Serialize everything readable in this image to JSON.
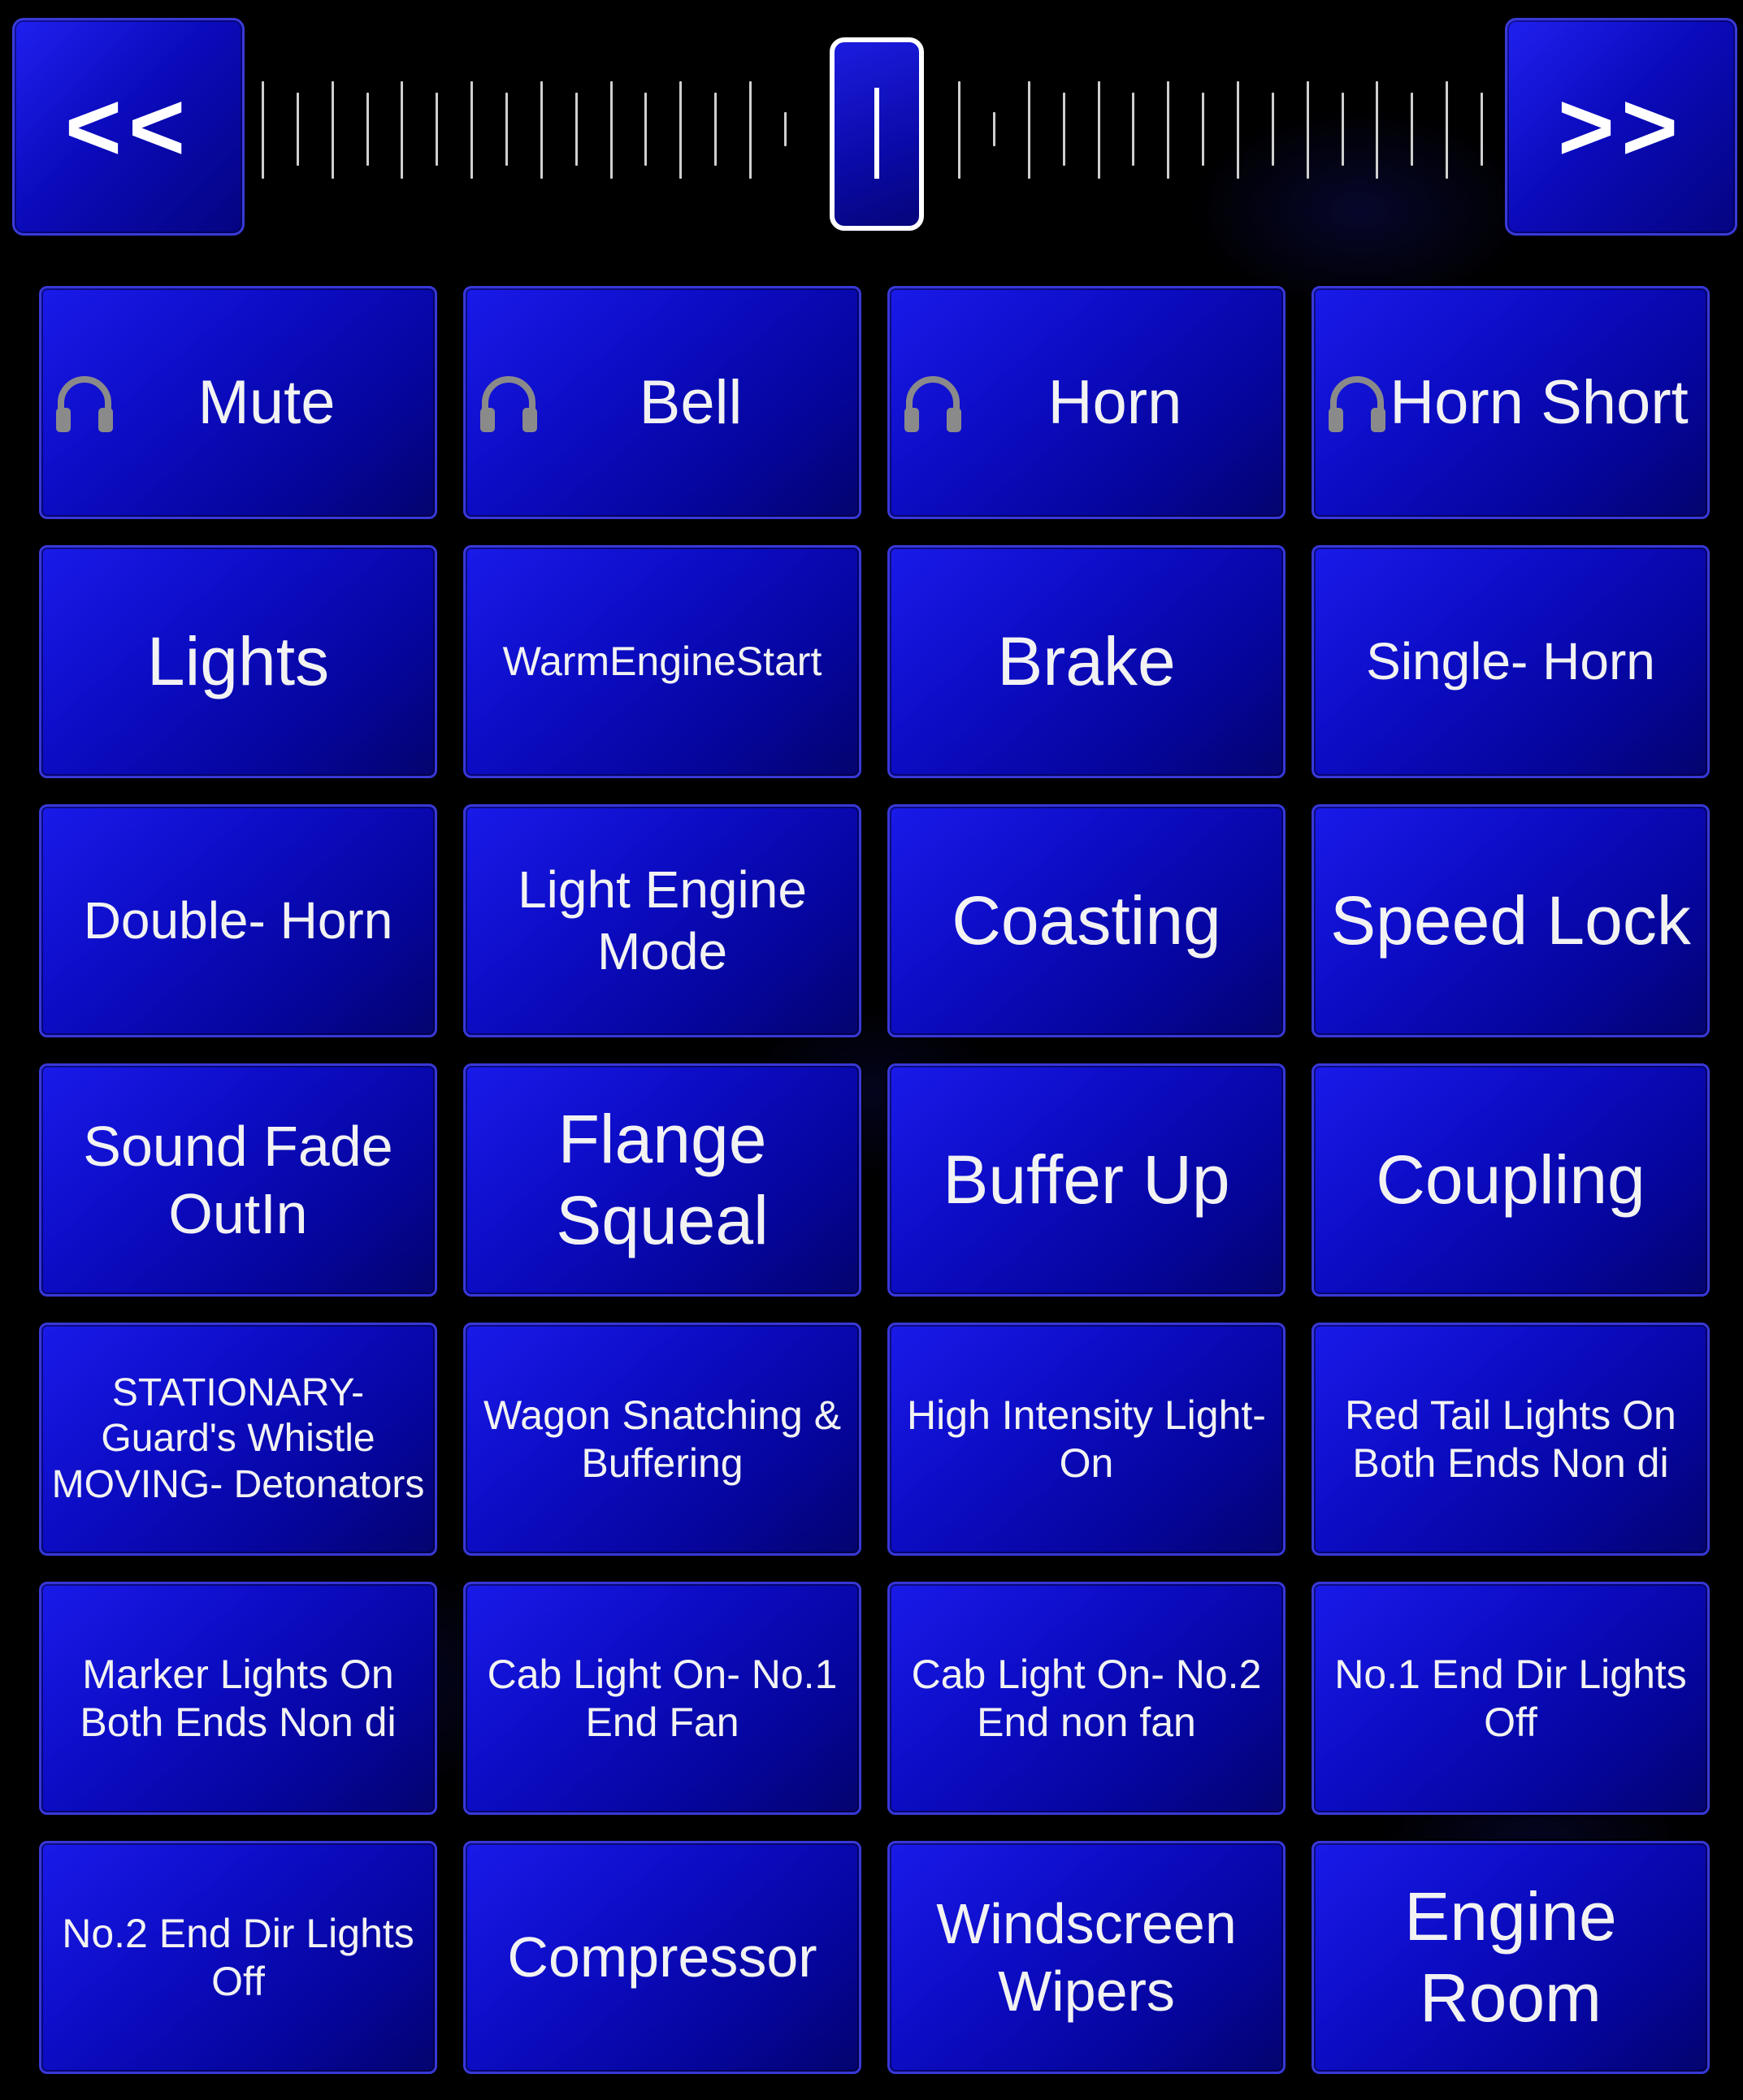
{
  "navigation": {
    "prev_label": "<<",
    "next_label": ">>"
  },
  "slider": {
    "tick_count": 36,
    "position_fraction": 0.5
  },
  "colors": {
    "button_blue": "#0c0cc4",
    "button_border": "#3838d8",
    "background": "#000000",
    "text": "#f2f2f2",
    "icon_gray": "#8a8a8a"
  },
  "functions": [
    {
      "label": "Mute",
      "icon": "headphones-icon"
    },
    {
      "label": "Bell",
      "icon": "headphones-icon"
    },
    {
      "label": "Horn",
      "icon": "headphones-icon"
    },
    {
      "label": "Horn Short",
      "icon": "headphones-icon"
    },
    {
      "label": "Lights"
    },
    {
      "label": "WarmEngineStart"
    },
    {
      "label": "Brake"
    },
    {
      "label": "Single- Horn"
    },
    {
      "label": "Double- Horn"
    },
    {
      "label": "Light Engine Mode"
    },
    {
      "label": "Coasting"
    },
    {
      "label": "Speed Lock"
    },
    {
      "label": "Sound Fade OutIn"
    },
    {
      "label": "Flange Squeal"
    },
    {
      "label": "Buffer Up"
    },
    {
      "label": "Coupling"
    },
    {
      "label": "STATIONARY- Guard's Whistle MOVING- Detonators"
    },
    {
      "label": "Wagon Snatching & Buffering"
    },
    {
      "label": "High Intensity Light- On"
    },
    {
      "label": "Red Tail Lights On Both Ends Non di"
    },
    {
      "label": "Marker Lights On Both Ends Non di"
    },
    {
      "label": "Cab Light On- No.1 End Fan"
    },
    {
      "label": "Cab Light On- No.2 End non fan"
    },
    {
      "label": "No.1 End Dir Lights Off"
    },
    {
      "label": "No.2 End Dir Lights Off"
    },
    {
      "label": "Compressor"
    },
    {
      "label": "Windscreen Wipers"
    },
    {
      "label": "Engine Room"
    }
  ]
}
